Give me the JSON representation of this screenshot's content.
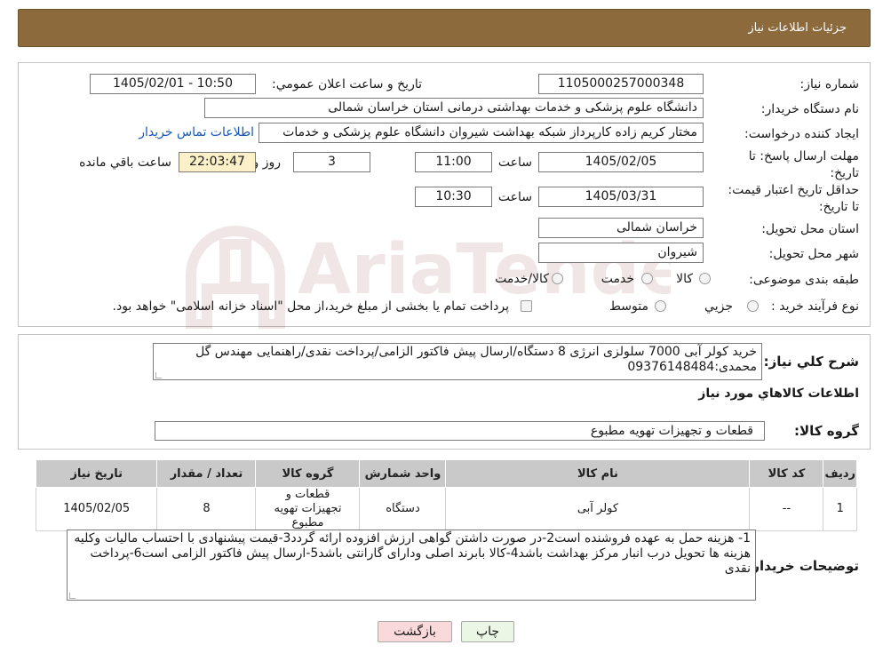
{
  "header": {
    "title": "جزئیات اطلاعات نیاز"
  },
  "watermark": {
    "text": "AriaTender.neT"
  },
  "form": {
    "need_number_label": "شماره نیاز:",
    "need_number": "1105000257000348",
    "announce_label": "تاريخ و ساعت اعلان عمومي:",
    "announce_value": "1405/02/01 - 10:50",
    "buyer_label": "نام دستگاه خريدار:",
    "buyer_value": "دانشگاه علوم پزشكی و خدمات بهداشتی درمانی استان خراسان شمالی",
    "creator_label": "ايجاد كننده درخواست:",
    "creator_value": "مختار کریم زاده کارپرداز شبکه بهداشت شیروان دانشگاه علوم پزشکی و خدمات",
    "contact_link": "اطلاعات تماس خريدار",
    "deadline_label": "مهلت ارسال پاسخ: تا تاريخ:",
    "deadline_date": "1405/02/05",
    "time_label": "ساعت",
    "deadline_time": "11:00",
    "days": "3",
    "days_label": "روز و",
    "remaining_time": "22:03:47",
    "remaining_label": "ساعت باقي مانده",
    "validity_label": "حداقل تاريخ اعتبار قيمت: تا تاريخ:",
    "validity_date": "1405/03/31",
    "validity_time_label": "ساعت",
    "validity_time": "10:30",
    "province_label": "استان محل تحويل:",
    "province_value": "خراسان شمالی",
    "city_label": "شهر محل تحويل:",
    "city_value": "شیروان",
    "category_label": "طبقه بندی موضوعی:",
    "category_options": [
      "كالا",
      "خدمت",
      "كالا/خدمت"
    ],
    "process_label": "نوع فرآيند خريد :",
    "process_options": [
      "جزيي",
      "متوسط"
    ],
    "process_note": "پرداخت تمام يا بخشی از مبلغ خريد،از محل \"اسناد خزانه اسلامی\" خواهد بود."
  },
  "summary": {
    "label": "شرح كلي نياز:",
    "text": "خرید کولر آبی 7000 سلولزی انرژی 8 دستگاه/ارسال پیش فاکتور الزامی/پرداخت نقدی/راهنمایی مهندس گل محمدی:09376148484",
    "goods_info_label": "اطلاعات كالاهاي مورد نياز",
    "goods_group_label": "گروه كالا:",
    "goods_group_value": "قطعات و تجهیزات تهویه مطبوع"
  },
  "table": {
    "headers": [
      "رديف",
      "كد كالا",
      "نام كالا",
      "واحد شمارش",
      "گروه كالا",
      "تعداد / مقدار",
      "تاريخ نياز"
    ],
    "rows": [
      [
        "1",
        "--",
        "كولر آبی",
        "دستگاه",
        "قطعات و تجهیزات تهویه مطبوع",
        "8",
        "1405/02/05"
      ]
    ]
  },
  "buyer_notes": {
    "label": "توضيحات خريدار:",
    "text": "1- هزینه حمل به عهده فروشنده است2-در صورت داشتن گواهی ارزش افزوده ارائه گردد3-قیمت پیشنهادی با احتساب مالیات وکلیه هزینه ها تحویل درب انبار مرکز بهداشت  باشد4-کالا بابرند اصلی ودارای گارانتی  باشد5-ارسال پیش فاکتور الزامی است6-پرداخت نقدی"
  },
  "buttons": {
    "print": "چاپ",
    "back": "بازگشت"
  },
  "colors": {
    "header_bg": "#8c6a3c",
    "table_header_bg": "#c9c9c9",
    "remaining_bg": "#fbf0c8",
    "back_bg": "#f9d9d9",
    "print_bg": "#eaf7e4",
    "link": "#1a57b5"
  }
}
